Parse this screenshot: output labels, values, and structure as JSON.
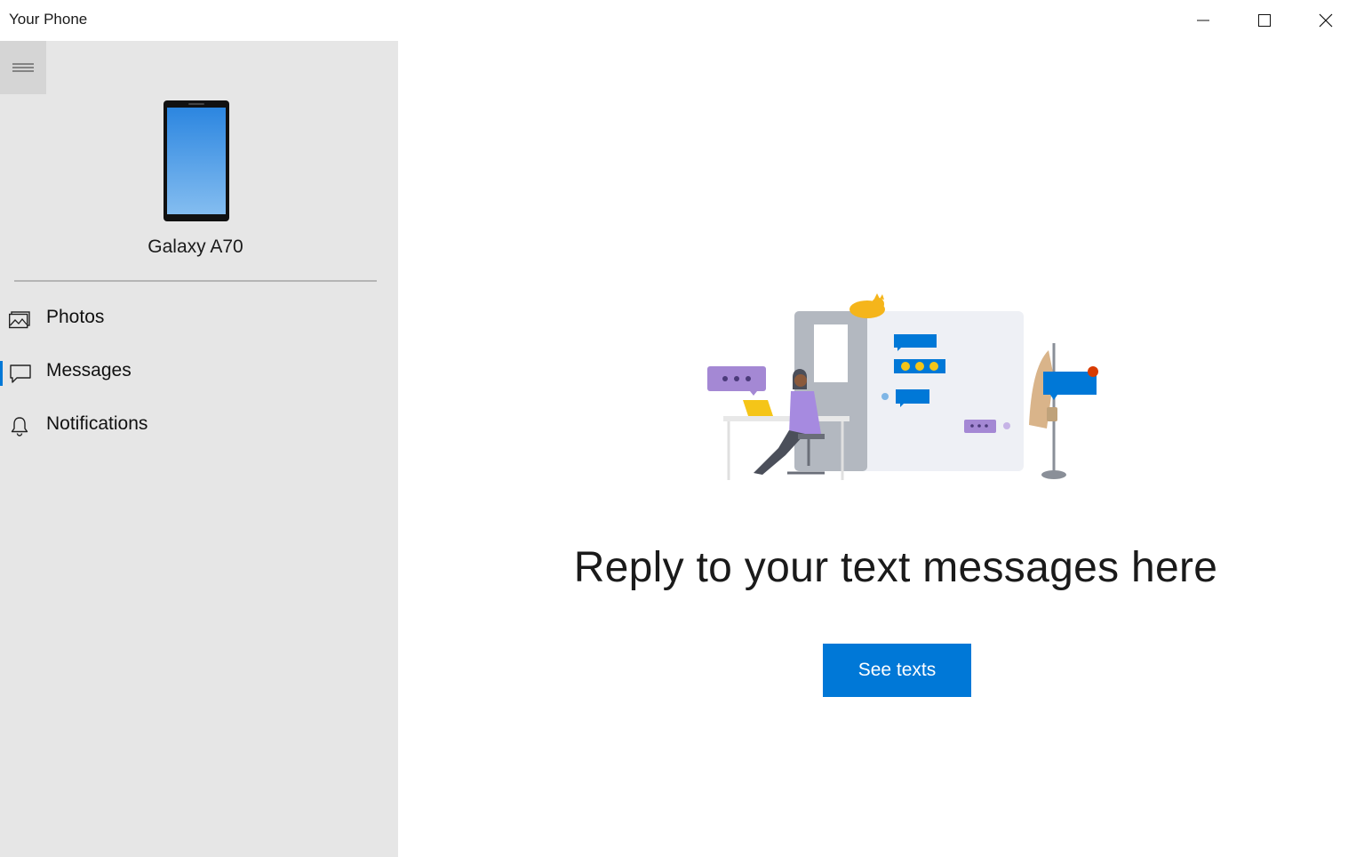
{
  "window": {
    "title": "Your Phone"
  },
  "sidebar": {
    "device_name": "Galaxy A70",
    "items": [
      {
        "label": "Photos",
        "icon": "photos-icon",
        "selected": false
      },
      {
        "label": "Messages",
        "icon": "message-icon",
        "selected": true
      },
      {
        "label": "Notifications",
        "icon": "bell-icon",
        "selected": false
      }
    ]
  },
  "main": {
    "headline": "Reply to your text messages here",
    "button_label": "See texts"
  },
  "colors": {
    "accent": "#0078d7",
    "sidebar_bg": "#e6e6e6",
    "main_bg": "#ffffff"
  }
}
